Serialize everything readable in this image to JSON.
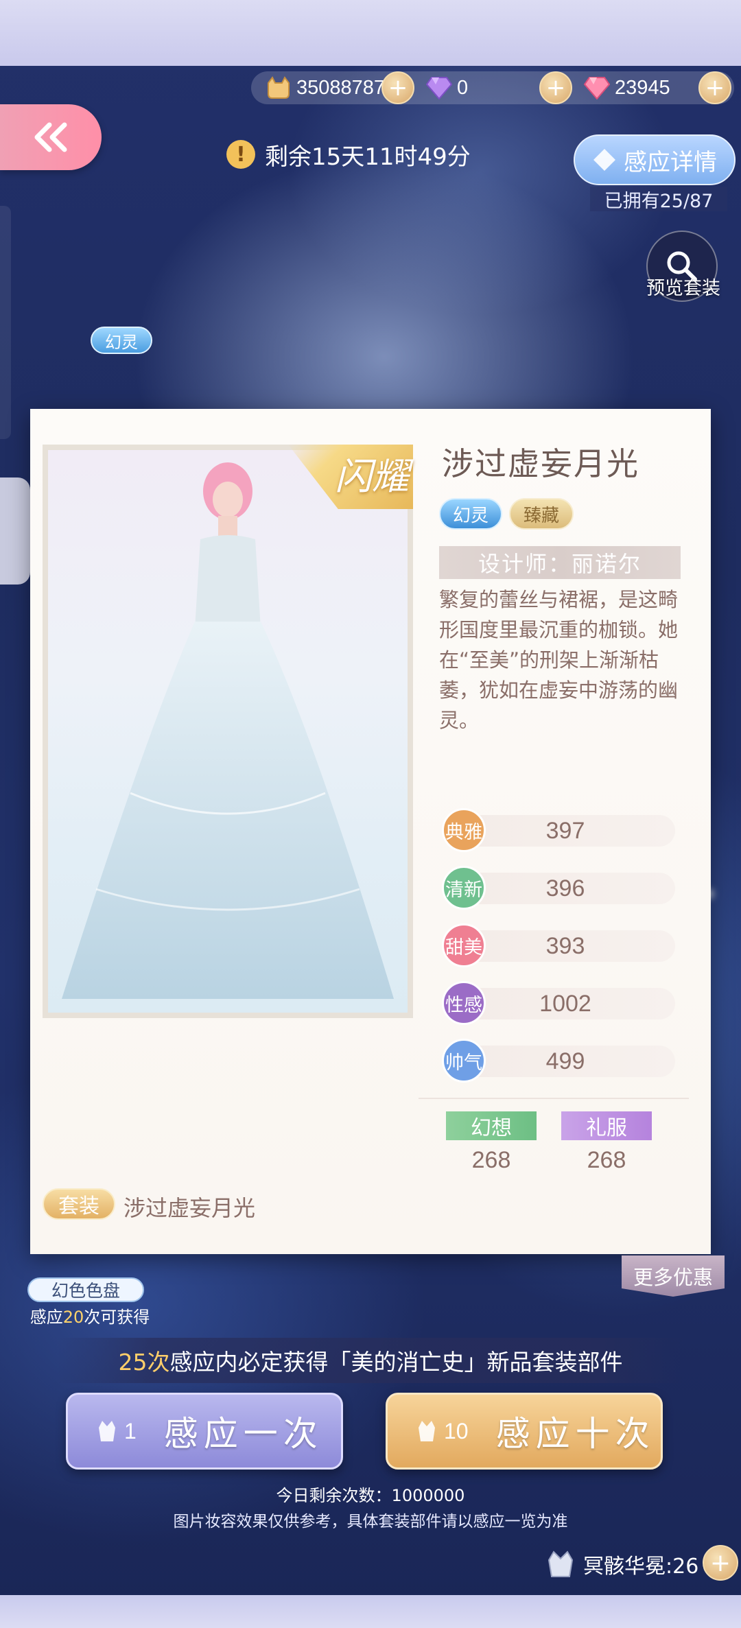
{
  "currency": {
    "coins": "35088787",
    "diamonds": "0",
    "crystals": "23945"
  },
  "timer": {
    "text": "剩余15天11时49分"
  },
  "induction": {
    "detail_label": "感应详情",
    "owned_text": "已拥有25/87"
  },
  "preview": {
    "label": "预览套装"
  },
  "floating_tag": "幻灵",
  "card": {
    "shine_badge": "闪耀",
    "title": "涉过虚妄月光",
    "tags": [
      "幻灵",
      "臻藏"
    ],
    "designer": "设计师：丽诺尔",
    "description": "繁复的蕾丝与裙裾，是这畸形国度里最沉重的枷锁。她在“至美”的刑架上渐渐枯萎，犹如在虚妄中游荡的幽灵。",
    "attributes": [
      {
        "label": "典雅",
        "value": "397",
        "color": "#e9a35c"
      },
      {
        "label": "清新",
        "value": "396",
        "color": "#6fc08f"
      },
      {
        "label": "甜美",
        "value": "393",
        "color": "#ef7f92"
      },
      {
        "label": "性感",
        "value": "1002",
        "color": "#9b6cc6"
      },
      {
        "label": "帅气",
        "value": "499",
        "color": "#6f9fe6"
      }
    ],
    "badges": [
      {
        "label": "幻想",
        "value": "268"
      },
      {
        "label": "礼服",
        "value": "268"
      }
    ],
    "suit_label": "套装",
    "suit_name": "涉过虚妄月光"
  },
  "more_offers": "更多优惠",
  "palette": {
    "label": "幻色色盘",
    "note_prefix": "感应",
    "note_count": "20",
    "note_suffix": "次可获得"
  },
  "guarantee": {
    "count": "25次",
    "text": "感应内必定获得「美的消亡史」新品套装部件"
  },
  "draw": {
    "one_count": "1",
    "one_label": "感应一次",
    "ten_count": "10",
    "ten_label": "感应十次"
  },
  "remaining": "今日剩余次数：1000000",
  "disclaimer": "图片妆容效果仅供参考，具体套装部件请以感应一览为准",
  "bottom_currency": {
    "label": "冥骸华冕:26"
  }
}
